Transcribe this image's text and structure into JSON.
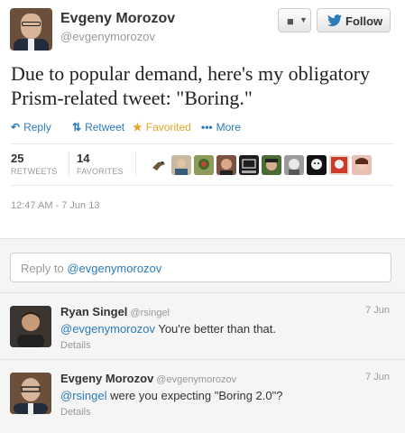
{
  "tweet": {
    "author_name": "Evgeny Morozov",
    "author_handle": "@evgenymorozov",
    "follow_label": "Follow",
    "user_menu_icon": "user-dropdown-icon",
    "text": "Due to popular demand, here's my obligatory Prism-related tweet: \"Boring.\"",
    "actions": {
      "reply": "Reply",
      "retweet": "Retweet",
      "favorited": "Favorited",
      "more": "More"
    },
    "stats": {
      "retweets_count": "25",
      "retweets_label": "RETWEETS",
      "favorites_count": "14",
      "favorites_label": "FAVORITES"
    },
    "timestamp": "12:47 AM - 7 Jun 13"
  },
  "reply_box": {
    "prefix": "Reply to ",
    "mention": "@evgenymorozov"
  },
  "replies": [
    {
      "name": "Ryan Singel",
      "handle": "@rsingel",
      "date": "7 Jun",
      "mention": "@evgenymorozov",
      "text": " You're better than that.",
      "details": "Details"
    },
    {
      "name": "Evgeny Morozov",
      "handle": "@evgenymorozov",
      "date": "7 Jun",
      "mention": "@rsingel",
      "text": " were you expecting \"Boring 2.0\"?",
      "details": "Details"
    }
  ],
  "colors": {
    "link_blue": "#2b7bb9",
    "favorite_gold": "#e2a52b",
    "muted_gray": "#999999"
  }
}
